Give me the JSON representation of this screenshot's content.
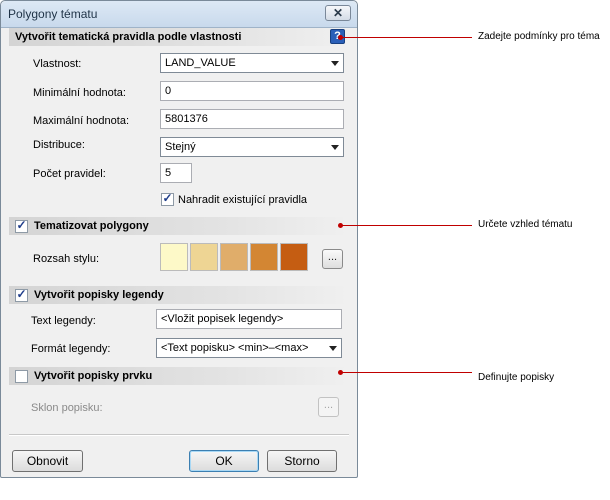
{
  "window": {
    "title": "Polygony tématu",
    "close_label": "✕"
  },
  "section_rules": {
    "title": "Vytvořit tematická pravidla podle vlastnosti",
    "help_label": "?",
    "property_label": "Vlastnost:",
    "property_value": "LAND_VALUE",
    "min_label": "Minimální hodnota:",
    "min_value": "0",
    "max_label": "Maximální hodnota:",
    "max_value": "5801376",
    "distribution_label": "Distribuce:",
    "distribution_value": "Stejný",
    "rule_count_label": "Počet pravidel:",
    "rule_count_value": "5",
    "replace_rules_label": "Nahradit existující pravidla",
    "replace_rules_checked": true
  },
  "section_theme": {
    "title": "Tematizovat polygony",
    "checked": true,
    "style_range_label": "Rozsah stylu:",
    "swatch_colors": [
      "#fdf9c8",
      "#eed594",
      "#e0ad6a",
      "#d38633",
      "#c55d12"
    ],
    "browse_label": "..."
  },
  "section_legend": {
    "title": "Vytvořit popisky legendy",
    "checked": true,
    "text_label": "Text legendy:",
    "text_value": "<Vložit popisek legendy>",
    "format_label": "Formát legendy:",
    "format_value": "<Text popisku> <min>–<max>"
  },
  "section_feature": {
    "title": "Vytvořit popisky prvku",
    "checked": false,
    "tilt_label": "Sklon popisku:",
    "browse_label": "..."
  },
  "buttons": {
    "reset": "Obnovit",
    "ok": "OK",
    "cancel": "Storno"
  },
  "annotations": {
    "conditions": "Zadejte podmínky pro téma",
    "appearance": "Určete vzhled tématu",
    "labels": "Definujte popisky"
  },
  "colors": {
    "callout": "#c00000",
    "help_icon": "#2a5fb8"
  }
}
